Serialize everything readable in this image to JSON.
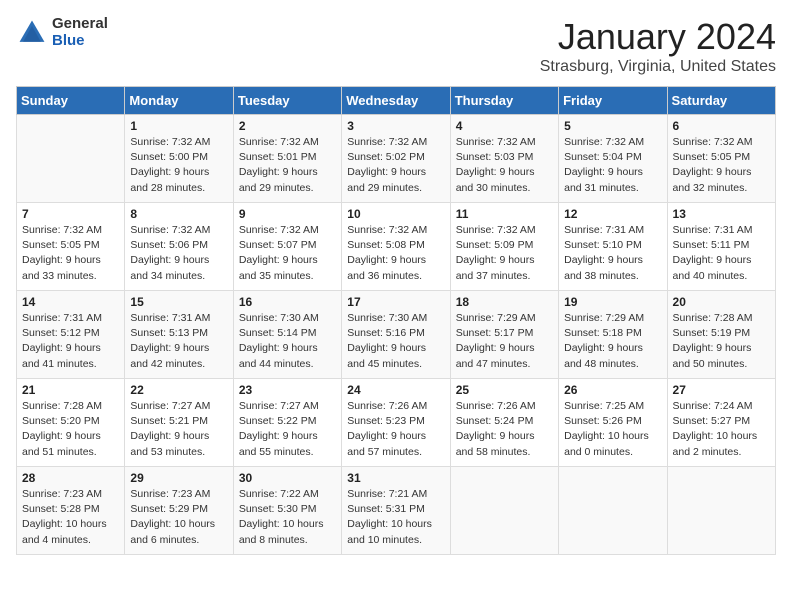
{
  "logo": {
    "general": "General",
    "blue": "Blue"
  },
  "title": "January 2024",
  "location": "Strasburg, Virginia, United States",
  "days_of_week": [
    "Sunday",
    "Monday",
    "Tuesday",
    "Wednesday",
    "Thursday",
    "Friday",
    "Saturday"
  ],
  "weeks": [
    [
      {
        "day": "",
        "info": ""
      },
      {
        "day": "1",
        "info": "Sunrise: 7:32 AM\nSunset: 5:00 PM\nDaylight: 9 hours\nand 28 minutes."
      },
      {
        "day": "2",
        "info": "Sunrise: 7:32 AM\nSunset: 5:01 PM\nDaylight: 9 hours\nand 29 minutes."
      },
      {
        "day": "3",
        "info": "Sunrise: 7:32 AM\nSunset: 5:02 PM\nDaylight: 9 hours\nand 29 minutes."
      },
      {
        "day": "4",
        "info": "Sunrise: 7:32 AM\nSunset: 5:03 PM\nDaylight: 9 hours\nand 30 minutes."
      },
      {
        "day": "5",
        "info": "Sunrise: 7:32 AM\nSunset: 5:04 PM\nDaylight: 9 hours\nand 31 minutes."
      },
      {
        "day": "6",
        "info": "Sunrise: 7:32 AM\nSunset: 5:05 PM\nDaylight: 9 hours\nand 32 minutes."
      }
    ],
    [
      {
        "day": "7",
        "info": "Sunrise: 7:32 AM\nSunset: 5:05 PM\nDaylight: 9 hours\nand 33 minutes."
      },
      {
        "day": "8",
        "info": "Sunrise: 7:32 AM\nSunset: 5:06 PM\nDaylight: 9 hours\nand 34 minutes."
      },
      {
        "day": "9",
        "info": "Sunrise: 7:32 AM\nSunset: 5:07 PM\nDaylight: 9 hours\nand 35 minutes."
      },
      {
        "day": "10",
        "info": "Sunrise: 7:32 AM\nSunset: 5:08 PM\nDaylight: 9 hours\nand 36 minutes."
      },
      {
        "day": "11",
        "info": "Sunrise: 7:32 AM\nSunset: 5:09 PM\nDaylight: 9 hours\nand 37 minutes."
      },
      {
        "day": "12",
        "info": "Sunrise: 7:31 AM\nSunset: 5:10 PM\nDaylight: 9 hours\nand 38 minutes."
      },
      {
        "day": "13",
        "info": "Sunrise: 7:31 AM\nSunset: 5:11 PM\nDaylight: 9 hours\nand 40 minutes."
      }
    ],
    [
      {
        "day": "14",
        "info": "Sunrise: 7:31 AM\nSunset: 5:12 PM\nDaylight: 9 hours\nand 41 minutes."
      },
      {
        "day": "15",
        "info": "Sunrise: 7:31 AM\nSunset: 5:13 PM\nDaylight: 9 hours\nand 42 minutes."
      },
      {
        "day": "16",
        "info": "Sunrise: 7:30 AM\nSunset: 5:14 PM\nDaylight: 9 hours\nand 44 minutes."
      },
      {
        "day": "17",
        "info": "Sunrise: 7:30 AM\nSunset: 5:16 PM\nDaylight: 9 hours\nand 45 minutes."
      },
      {
        "day": "18",
        "info": "Sunrise: 7:29 AM\nSunset: 5:17 PM\nDaylight: 9 hours\nand 47 minutes."
      },
      {
        "day": "19",
        "info": "Sunrise: 7:29 AM\nSunset: 5:18 PM\nDaylight: 9 hours\nand 48 minutes."
      },
      {
        "day": "20",
        "info": "Sunrise: 7:28 AM\nSunset: 5:19 PM\nDaylight: 9 hours\nand 50 minutes."
      }
    ],
    [
      {
        "day": "21",
        "info": "Sunrise: 7:28 AM\nSunset: 5:20 PM\nDaylight: 9 hours\nand 51 minutes."
      },
      {
        "day": "22",
        "info": "Sunrise: 7:27 AM\nSunset: 5:21 PM\nDaylight: 9 hours\nand 53 minutes."
      },
      {
        "day": "23",
        "info": "Sunrise: 7:27 AM\nSunset: 5:22 PM\nDaylight: 9 hours\nand 55 minutes."
      },
      {
        "day": "24",
        "info": "Sunrise: 7:26 AM\nSunset: 5:23 PM\nDaylight: 9 hours\nand 57 minutes."
      },
      {
        "day": "25",
        "info": "Sunrise: 7:26 AM\nSunset: 5:24 PM\nDaylight: 9 hours\nand 58 minutes."
      },
      {
        "day": "26",
        "info": "Sunrise: 7:25 AM\nSunset: 5:26 PM\nDaylight: 10 hours\nand 0 minutes."
      },
      {
        "day": "27",
        "info": "Sunrise: 7:24 AM\nSunset: 5:27 PM\nDaylight: 10 hours\nand 2 minutes."
      }
    ],
    [
      {
        "day": "28",
        "info": "Sunrise: 7:23 AM\nSunset: 5:28 PM\nDaylight: 10 hours\nand 4 minutes."
      },
      {
        "day": "29",
        "info": "Sunrise: 7:23 AM\nSunset: 5:29 PM\nDaylight: 10 hours\nand 6 minutes."
      },
      {
        "day": "30",
        "info": "Sunrise: 7:22 AM\nSunset: 5:30 PM\nDaylight: 10 hours\nand 8 minutes."
      },
      {
        "day": "31",
        "info": "Sunrise: 7:21 AM\nSunset: 5:31 PM\nDaylight: 10 hours\nand 10 minutes."
      },
      {
        "day": "",
        "info": ""
      },
      {
        "day": "",
        "info": ""
      },
      {
        "day": "",
        "info": ""
      }
    ]
  ]
}
